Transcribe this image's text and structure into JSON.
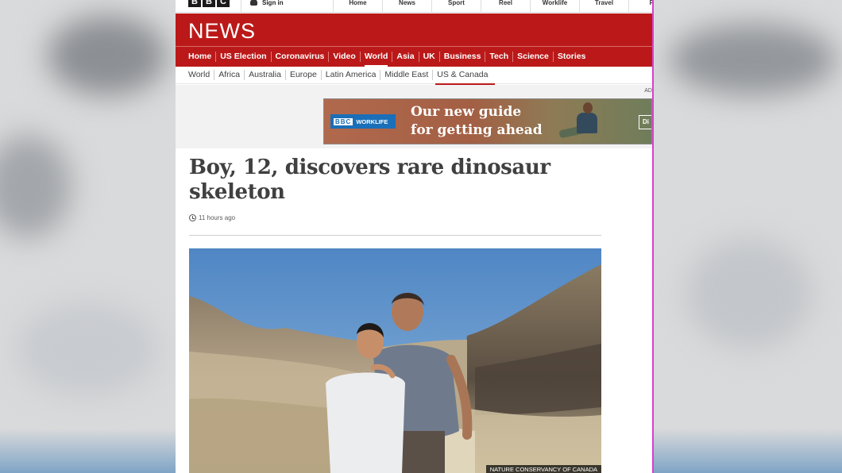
{
  "top_bar": {
    "logo_letters": [
      "B",
      "B",
      "C"
    ],
    "sign_in_label": "Sign in",
    "sign_in_icon": "user-icon",
    "nav_items": [
      "Home",
      "News",
      "Sport",
      "Reel",
      "Worklife",
      "Travel",
      "Fu"
    ]
  },
  "masthead": {
    "title": "NEWS"
  },
  "main_nav": {
    "items": [
      "Home",
      "US Election",
      "Coronavirus",
      "Video",
      "World",
      "Asia",
      "UK",
      "Business",
      "Tech",
      "Science",
      "Stories"
    ],
    "active": "World"
  },
  "sub_nav": {
    "items": [
      "World",
      "Africa",
      "Australia",
      "Europe",
      "Latin America",
      "Middle East",
      "US & Canada"
    ],
    "active": "US & Canada"
  },
  "ad": {
    "label": "AD",
    "brand_bbc": "BBC",
    "brand_name": "WORKLIFE",
    "headline_line1": "Our new guide",
    "headline_line2": "for getting ahead",
    "cta": "Di"
  },
  "article": {
    "headline": "Boy, 12, discovers rare dinosaur skeleton",
    "timestamp": "11 hours ago",
    "timestamp_icon": "clock-icon",
    "image_credit": "NATURE CONSERVANCY OF CANADA"
  },
  "colors": {
    "bbc_red": "#bb1919",
    "headline_text": "#404040",
    "sky_blue": "#5f8fc0"
  }
}
